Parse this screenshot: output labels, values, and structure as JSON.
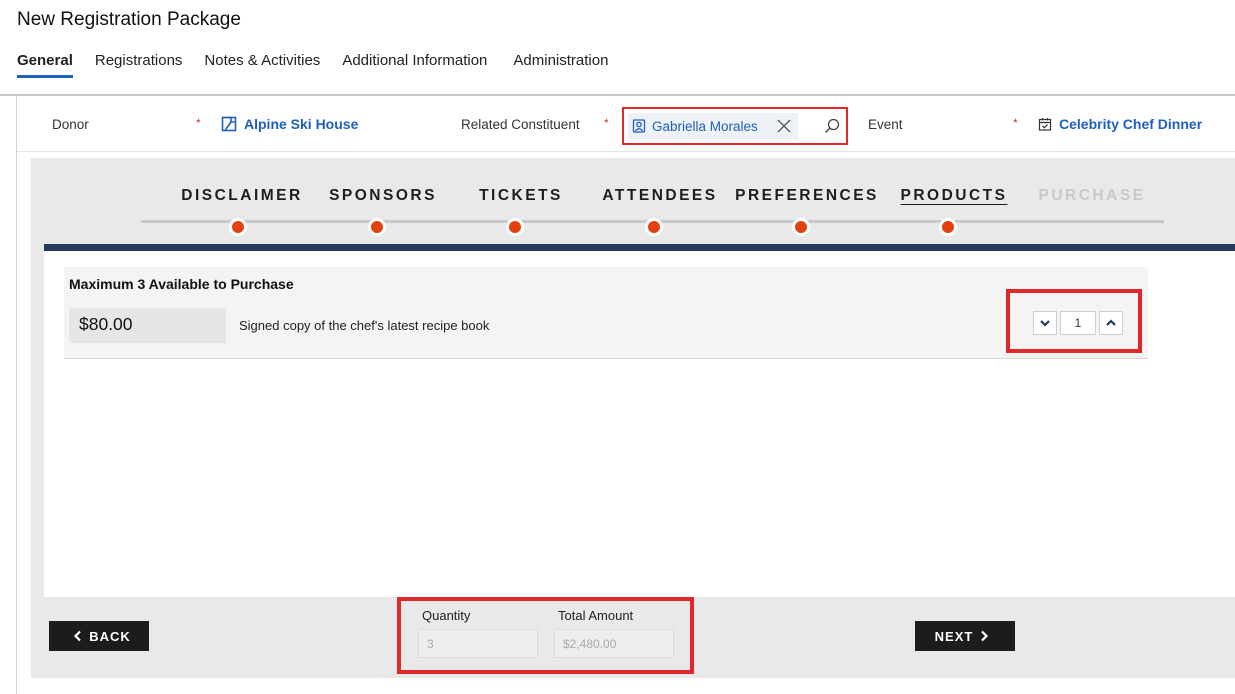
{
  "page": {
    "title": "New Registration Package"
  },
  "tabs": [
    {
      "label": "General",
      "active": true
    },
    {
      "label": "Registrations"
    },
    {
      "label": "Notes & Activities"
    },
    {
      "label": "Additional Information"
    },
    {
      "label": "Administration"
    }
  ],
  "fields": {
    "required_marker": "*",
    "donor": {
      "label": "Donor",
      "value": "Alpine Ski House",
      "icon": "account-icon"
    },
    "related_constituent": {
      "label": "Related Constituent",
      "value": "Gabriella Morales",
      "icon": "contact-icon"
    },
    "event": {
      "label": "Event",
      "value": "Celebrity Chef Dinner",
      "icon": "calendar-icon"
    }
  },
  "steps": [
    {
      "label": "DISCLAIMER"
    },
    {
      "label": "SPONSORS"
    },
    {
      "label": "TICKETS"
    },
    {
      "label": "ATTENDEES"
    },
    {
      "label": "PREFERENCES"
    },
    {
      "label": "PRODUCTS",
      "current": true
    },
    {
      "label": "PURCHASE",
      "disabled": true
    }
  ],
  "product": {
    "max_text": "Maximum 3 Available to Purchase",
    "price": "$80.00",
    "description": "Signed copy of the chef's latest recipe book",
    "quantity": "1"
  },
  "totals": {
    "quantity_label": "Quantity",
    "quantity_value": "3",
    "amount_label": "Total Amount",
    "amount_value": "$2,480.00"
  },
  "buttons": {
    "back": "BACK",
    "next": "NEXT"
  },
  "colors": {
    "accent": "#1f5fbf",
    "step_dot": "#e2400f",
    "navy_bar": "#273a5e",
    "highlight": "#e0272b"
  }
}
